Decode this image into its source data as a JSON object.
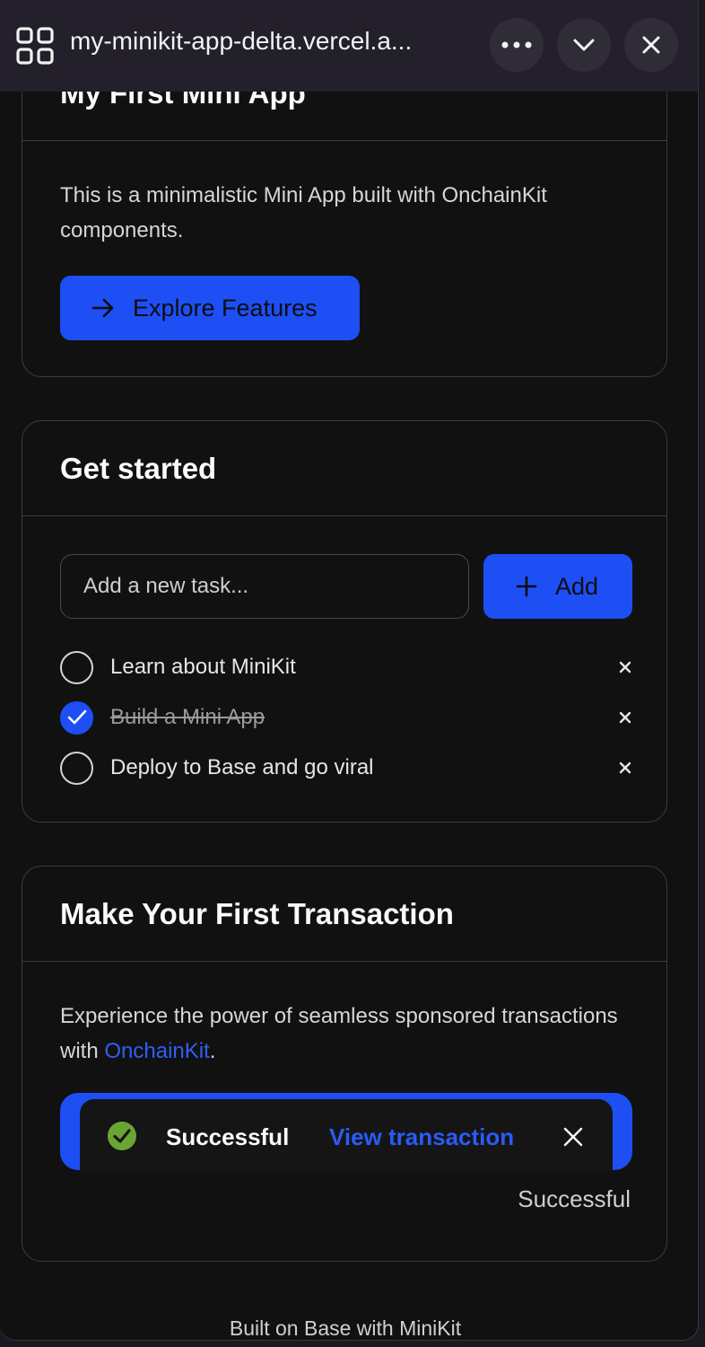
{
  "topbar": {
    "url": "my-minikit-app-delta.vercel.a...",
    "apps_icon": "grid-apps-icon",
    "more_icon": "more-horizontal-icon",
    "collapse_icon": "chevron-down-icon",
    "close_icon": "close-icon"
  },
  "intro_card": {
    "title": "My First Mini App",
    "description": "This is a minimalistic Mini App built with OnchainKit components.",
    "button_label": "Explore Features",
    "button_icon": "arrow-right-icon"
  },
  "tasks_card": {
    "title": "Get started",
    "input_placeholder": "Add a new task...",
    "add_label": "Add",
    "add_icon": "plus-icon",
    "tasks": [
      {
        "label": "Learn about MiniKit",
        "completed": false
      },
      {
        "label": "Build a Mini App",
        "completed": true
      },
      {
        "label": "Deploy to Base and go viral",
        "completed": false
      }
    ]
  },
  "tx_card": {
    "title": "Make Your First Transaction",
    "description_prefix": "Experience the power of seamless sponsored transactions with ",
    "description_link": "OnchainKit",
    "description_suffix": ".",
    "toast_status": "Successful",
    "toast_link": "View transaction",
    "status_text": "Successful"
  },
  "footer": {
    "text": "Built on Base with MiniKit"
  },
  "colors": {
    "accent": "#1d4ff5",
    "success": "#6aa532",
    "background": "#111111",
    "border": "#3d3d3d"
  }
}
